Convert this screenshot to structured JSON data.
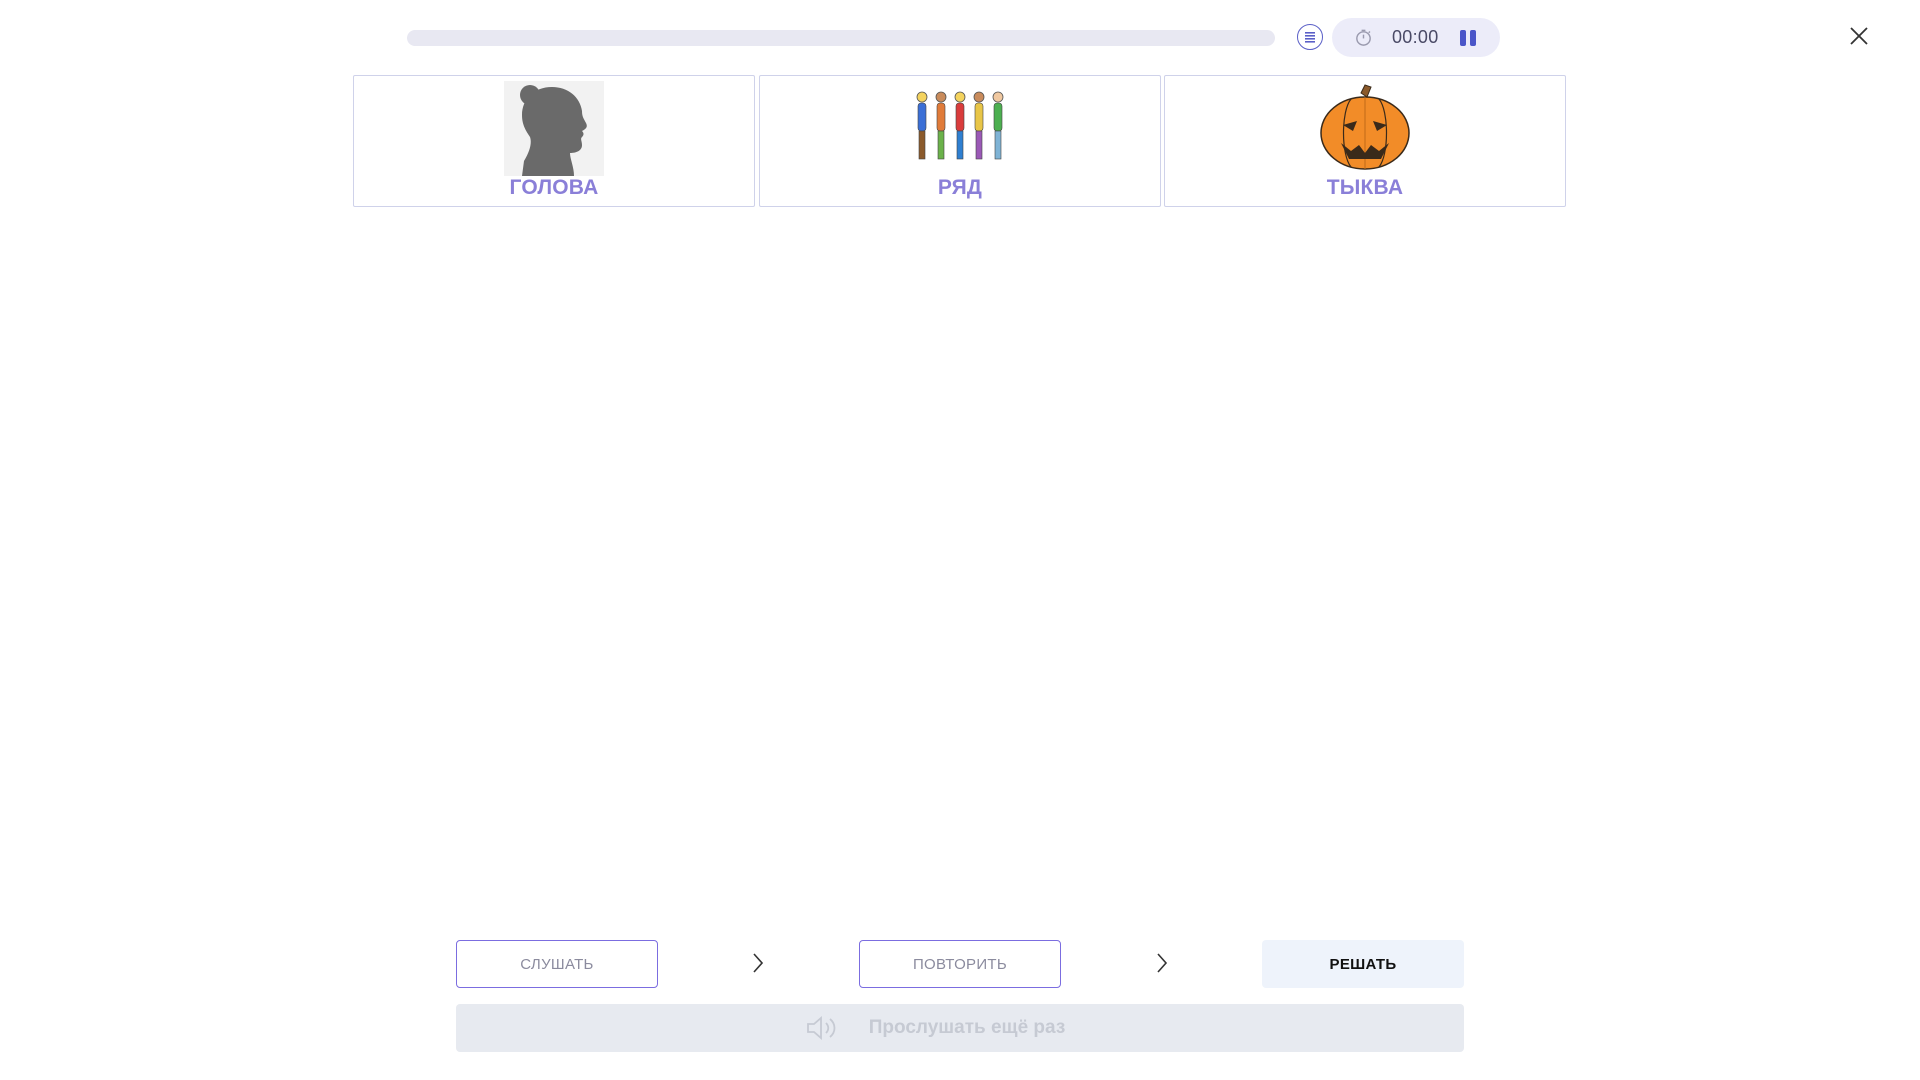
{
  "header": {
    "progress_fraction": 0,
    "timer": "00:00"
  },
  "cards": [
    {
      "word": "ГОЛОВА",
      "image": "head-silhouette"
    },
    {
      "word": "РЯД",
      "image": "row-of-people"
    },
    {
      "word": "ТЫКВА",
      "image": "pumpkin"
    }
  ],
  "steps": {
    "listen": "СЛУШАТЬ",
    "repeat": "ПОВТОРИТЬ",
    "solve": "РЕШАТЬ"
  },
  "replay": {
    "label": "Прослушать ещё раз"
  },
  "colors": {
    "accent": "#8a7fd8",
    "outline": "#7b6de0",
    "timer_bg": "#ececf9",
    "track": "#e8e8f2"
  }
}
